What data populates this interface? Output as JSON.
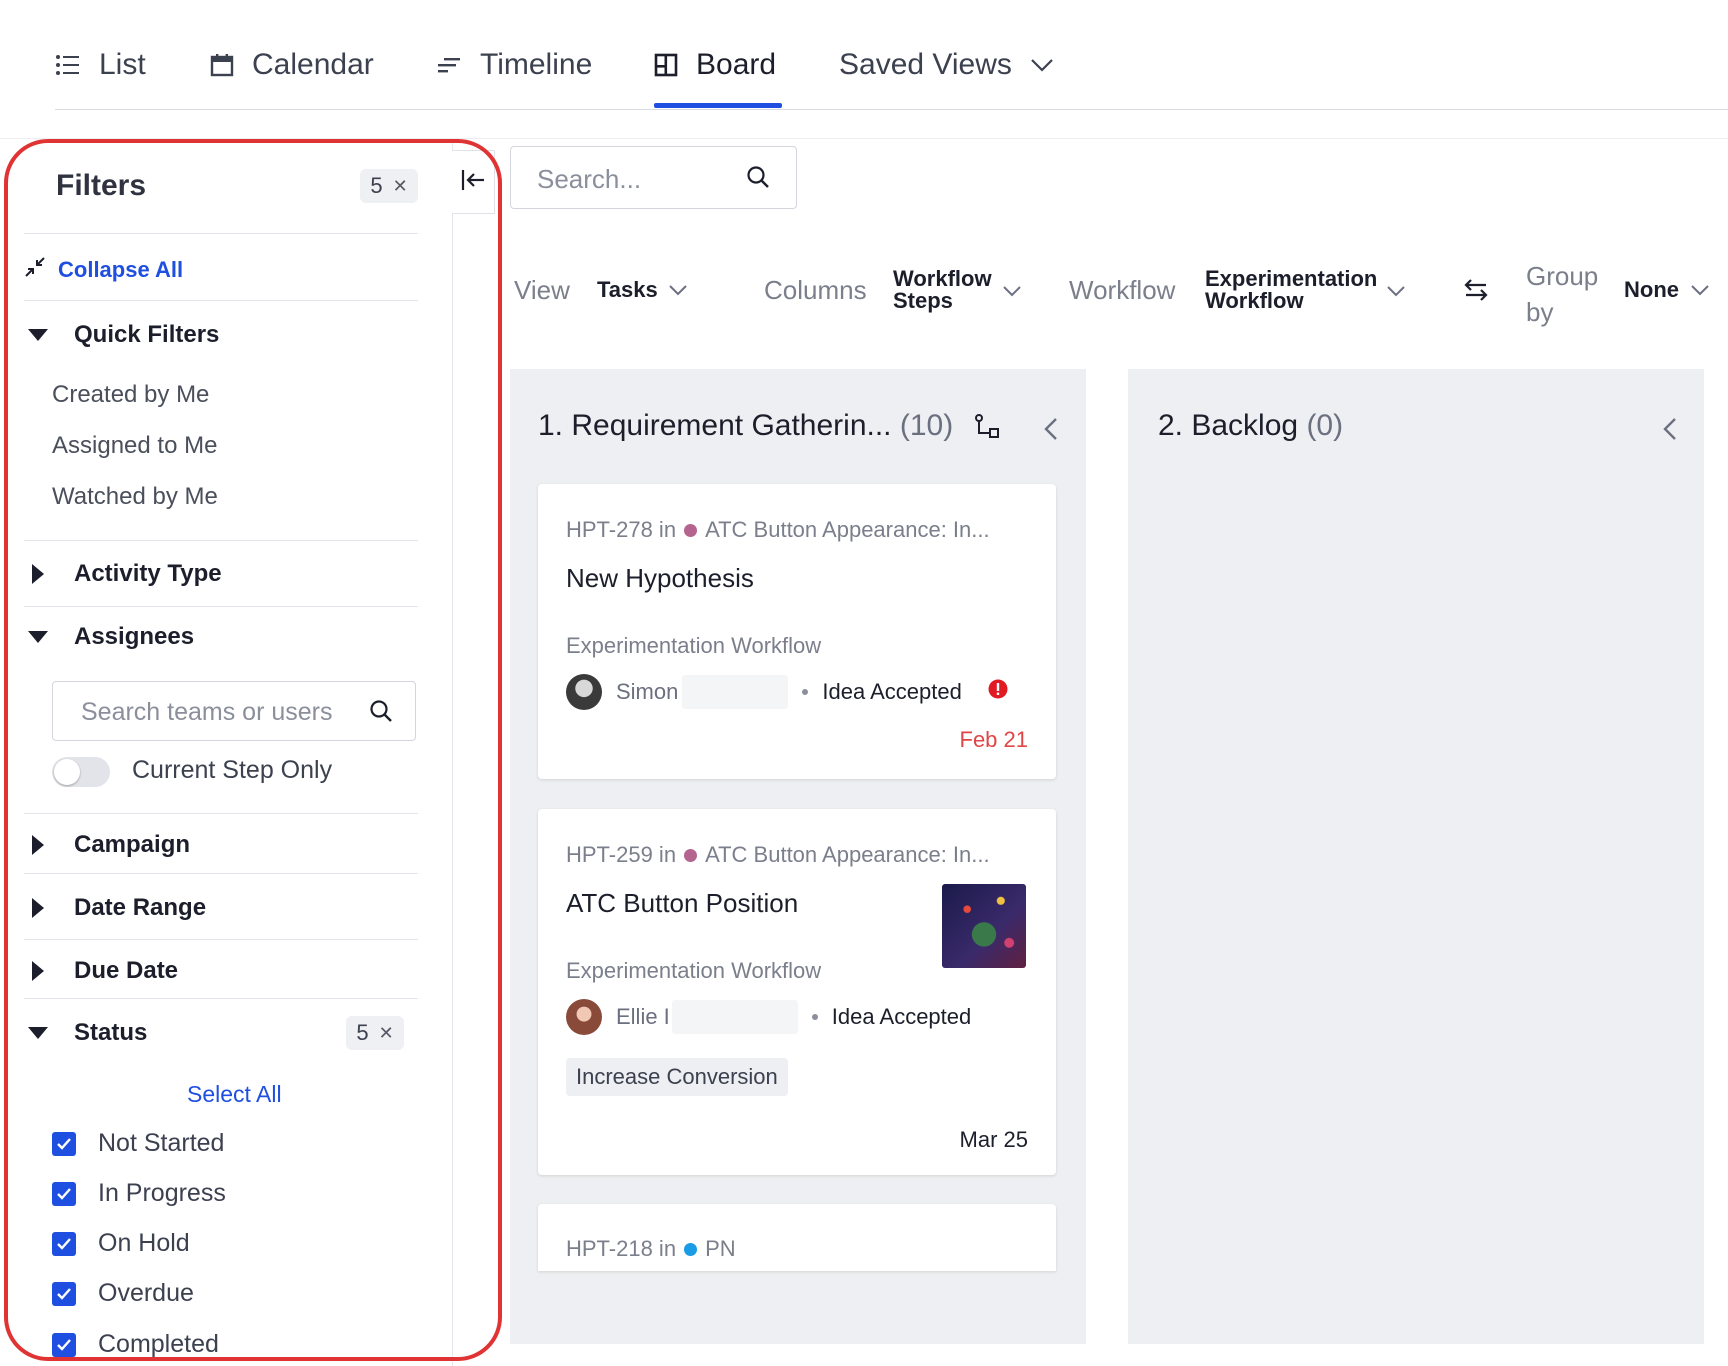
{
  "tabs": [
    {
      "label": "List",
      "icon": "list-icon"
    },
    {
      "label": "Calendar",
      "icon": "calendar-icon"
    },
    {
      "label": "Timeline",
      "icon": "timeline-icon"
    },
    {
      "label": "Board",
      "icon": "board-icon",
      "active": true
    },
    {
      "label": "Saved Views",
      "icon": "chevron-down-icon"
    }
  ],
  "filters": {
    "title": "Filters",
    "count": "5",
    "collapse_all": "Collapse All",
    "quick_filters": {
      "label": "Quick Filters",
      "items": [
        "Created by Me",
        "Assigned to Me",
        "Watched by Me"
      ]
    },
    "activity_type": "Activity Type",
    "assignees": {
      "label": "Assignees",
      "search_placeholder": "Search teams or users",
      "toggle_label": "Current Step Only"
    },
    "campaign": "Campaign",
    "date_range": "Date Range",
    "due_date": "Due Date",
    "status": {
      "label": "Status",
      "count": "5",
      "select_all": "Select All",
      "options": [
        "Not Started",
        "In Progress",
        "On Hold",
        "Overdue",
        "Completed"
      ]
    }
  },
  "toolbar": {
    "search_placeholder": "Search...",
    "view_label": "View",
    "view_value": "Tasks",
    "columns_label": "Columns",
    "columns_value_line1": "Workflow",
    "columns_value_line2": "Steps",
    "workflow_label": "Workflow",
    "workflow_value_line1": "Experimentation",
    "workflow_value_line2": "Workflow",
    "group_label_line1": "Group",
    "group_label_line2": "by",
    "group_value": "None"
  },
  "columns": [
    {
      "title": "1. Requirement Gatherin...",
      "count": "(10)",
      "cards": [
        {
          "id": "HPT-278 in",
          "project": "ATC Button Appearance: In...",
          "project_color": "#b5648f",
          "title": "New Hypothesis",
          "workflow": "Experimentation Workflow",
          "user": "Simon",
          "step": "Idea Accepted",
          "due": "Feb 21",
          "due_color": "#e04646"
        },
        {
          "id": "HPT-259 in",
          "project": "ATC Button Appearance: In...",
          "project_color": "#b5648f",
          "title": "ATC Button Position",
          "workflow": "Experimentation Workflow",
          "user": "Ellie I",
          "step": "Idea Accepted",
          "tag": "Increase Conversion",
          "due": "Mar 25",
          "due_color": "#1c1f2b"
        },
        {
          "id": "HPT-218 in",
          "project": "PN",
          "project_color": "#1a9be6"
        }
      ]
    },
    {
      "title": "2. Backlog",
      "count": "(0)",
      "cards": []
    }
  ],
  "colors": {
    "accent": "#1f4fe0",
    "highlight_outline": "#e03434",
    "column_bg": "#eeeff2"
  }
}
